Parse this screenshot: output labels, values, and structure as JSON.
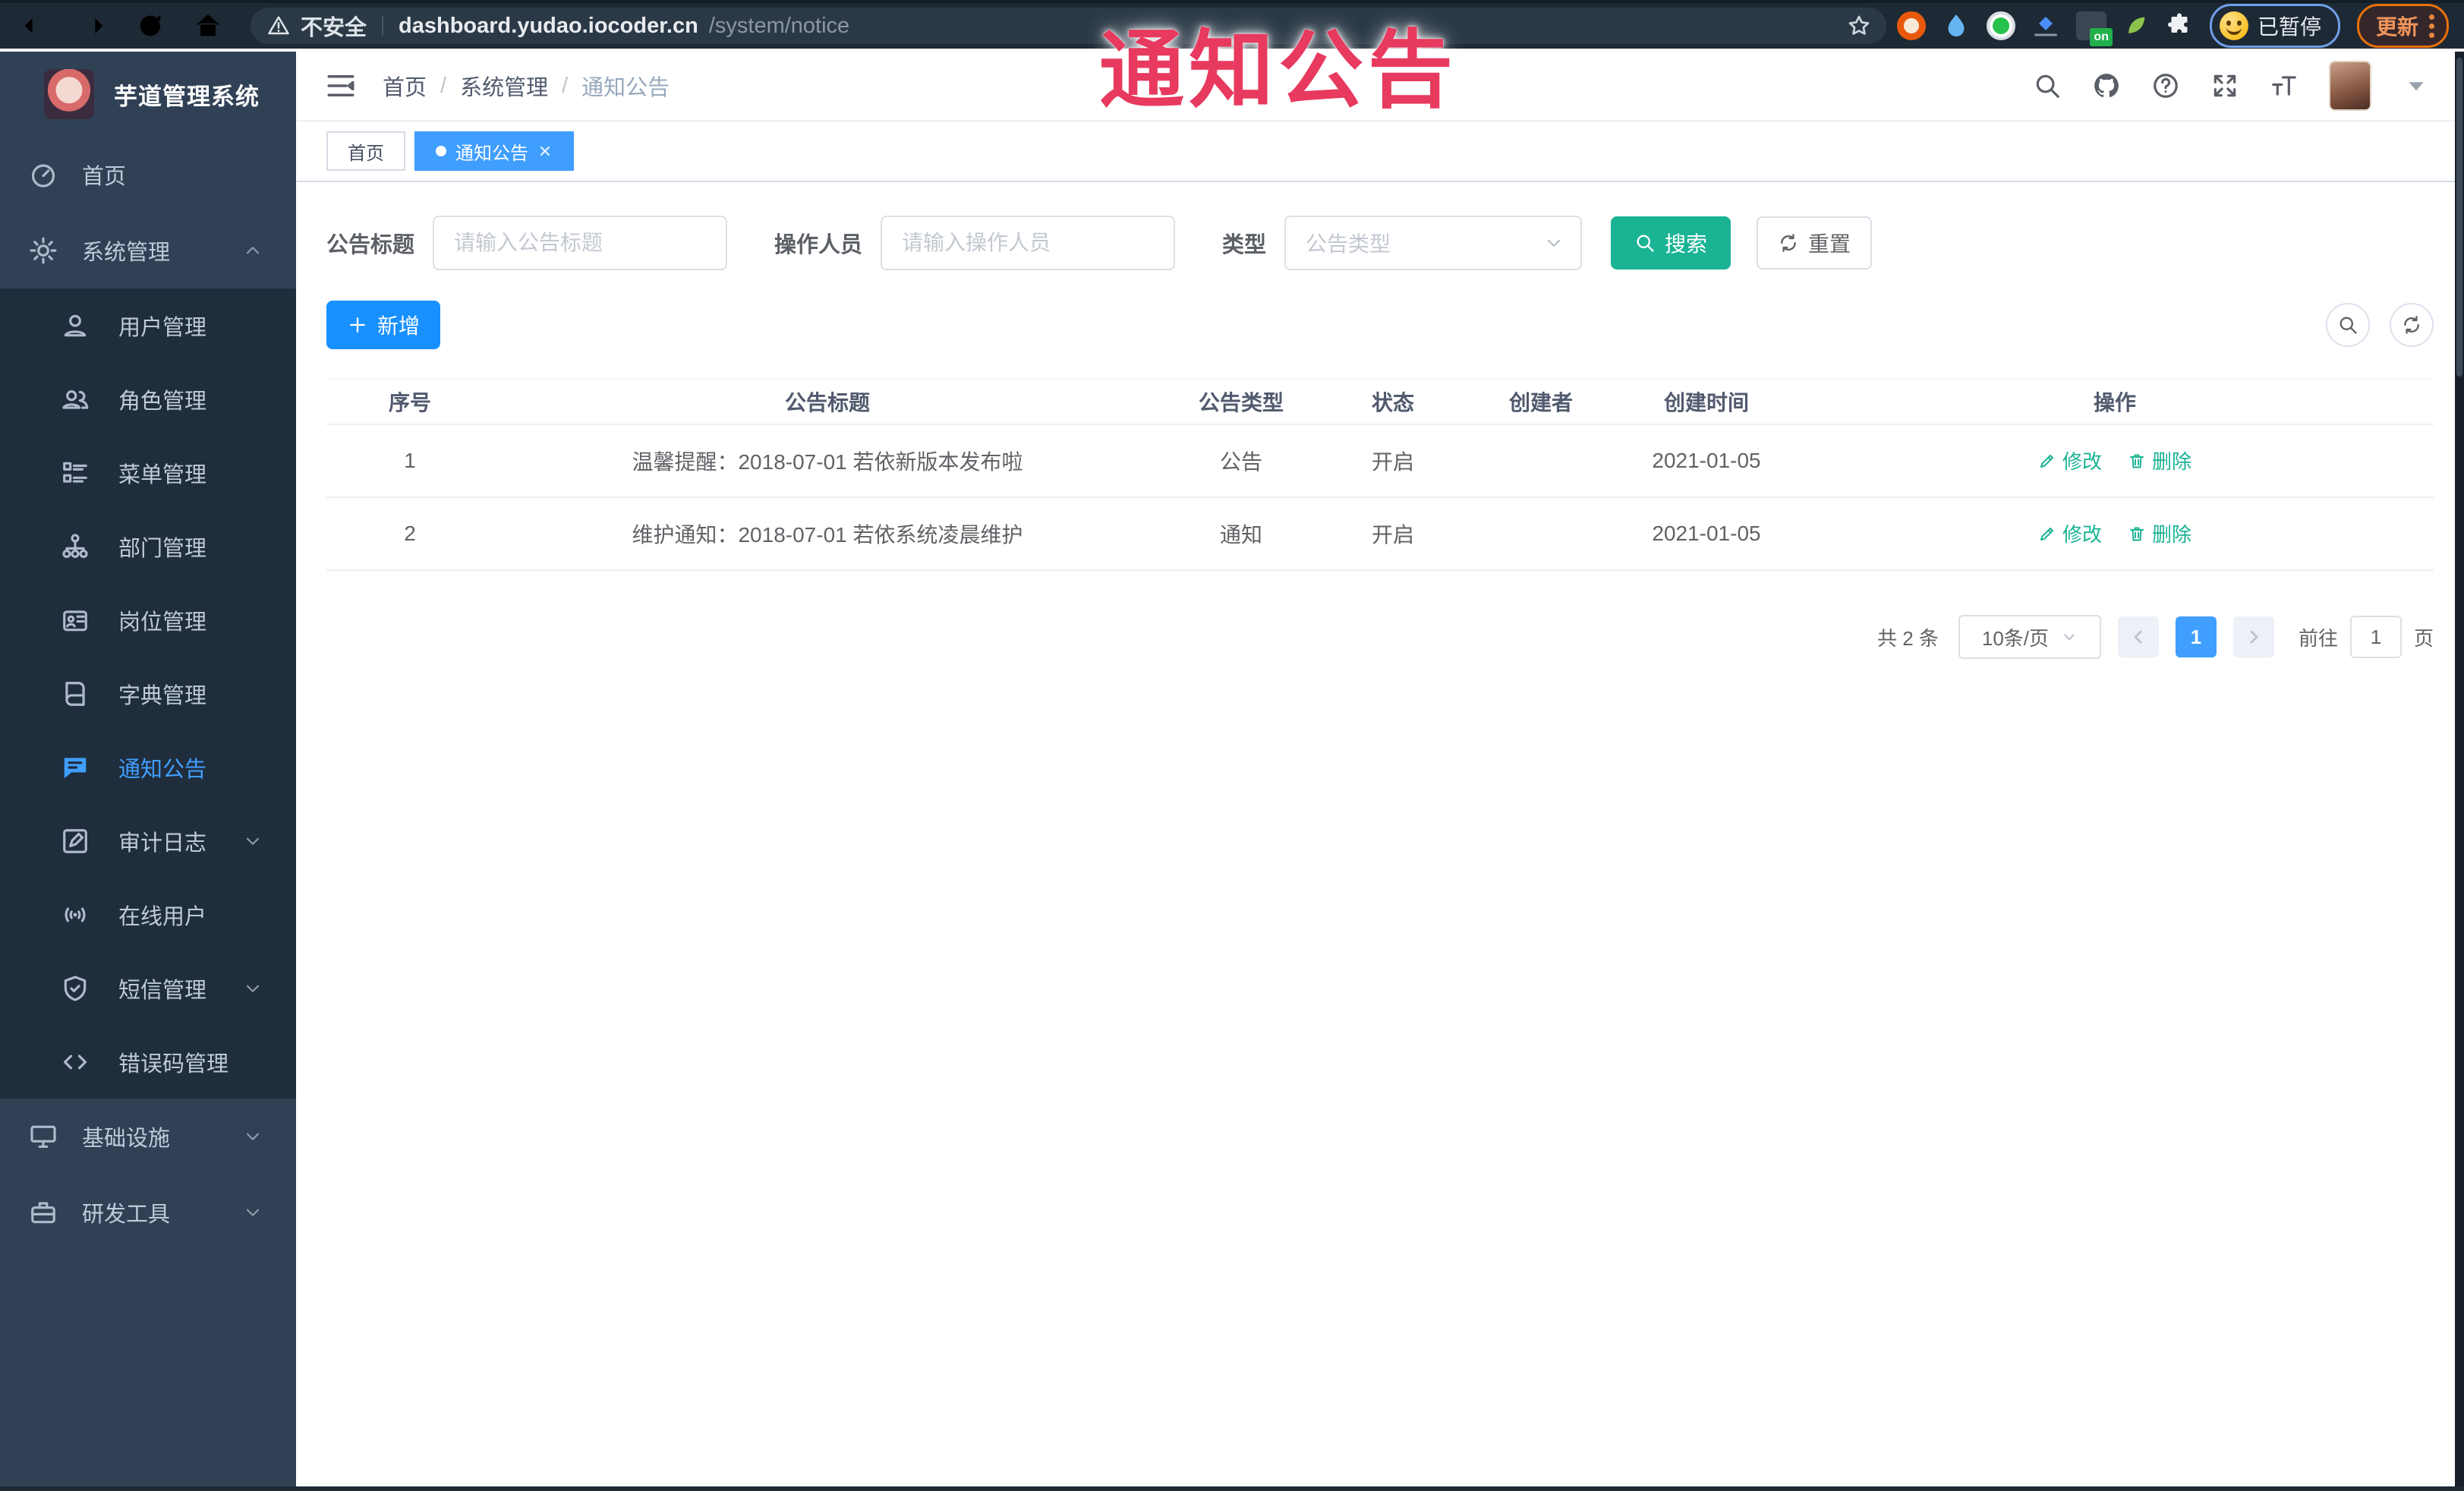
{
  "browser": {
    "security_label": "不安全",
    "url_host": "dashboard.yudao.iocoder.cn",
    "url_path": "/system/notice",
    "extension_on_badge": "on",
    "profile_status": "已暂停",
    "update_label": "更新"
  },
  "overlay_title": "通知公告",
  "sidebar": {
    "logo_title": "芋道管理系统",
    "items": [
      {
        "label": "首页"
      },
      {
        "label": "系统管理"
      },
      {
        "label": "用户管理"
      },
      {
        "label": "角色管理"
      },
      {
        "label": "菜单管理"
      },
      {
        "label": "部门管理"
      },
      {
        "label": "岗位管理"
      },
      {
        "label": "字典管理"
      },
      {
        "label": "通知公告"
      },
      {
        "label": "审计日志"
      },
      {
        "label": "在线用户"
      },
      {
        "label": "短信管理"
      },
      {
        "label": "错误码管理"
      },
      {
        "label": "基础设施"
      },
      {
        "label": "研发工具"
      }
    ]
  },
  "header": {
    "breadcrumb": [
      "首页",
      "系统管理",
      "通知公告"
    ],
    "separator": "/"
  },
  "tabs": [
    {
      "label": "首页"
    },
    {
      "label": "通知公告"
    }
  ],
  "search_form": {
    "title_label": "公告标题",
    "title_placeholder": "请输入公告标题",
    "operator_label": "操作人员",
    "operator_placeholder": "请输入操作人员",
    "type_label": "类型",
    "type_placeholder": "公告类型",
    "search_label": "搜索",
    "reset_label": "重置"
  },
  "toolbar": {
    "add_label": "新增"
  },
  "table": {
    "headers": [
      "序号",
      "公告标题",
      "公告类型",
      "状态",
      "创建者",
      "创建时间",
      "操作"
    ],
    "rows": [
      {
        "no": "1",
        "title": "温馨提醒：2018-07-01 若依新版本发布啦",
        "type": "公告",
        "status": "开启",
        "creator": "",
        "created": "2021-01-05",
        "edit": "修改",
        "delete": "删除"
      },
      {
        "no": "2",
        "title": "维护通知：2018-07-01 若依系统凌晨维护",
        "type": "通知",
        "status": "开启",
        "creator": "",
        "created": "2021-01-05",
        "edit": "修改",
        "delete": "删除"
      }
    ]
  },
  "pagination": {
    "total": "共 2 条",
    "page_size": "10条/页",
    "current_page": "1",
    "goto_label": "前往",
    "goto_value": "1",
    "page_unit": "页"
  },
  "colors": {
    "accent": "#409eff",
    "search_teal": "#1ab394",
    "add_blue": "#1890ff",
    "overlay_red": "#e8395f",
    "sidebar_bg": "#304156",
    "submenu_bg": "#1f2d3d"
  }
}
